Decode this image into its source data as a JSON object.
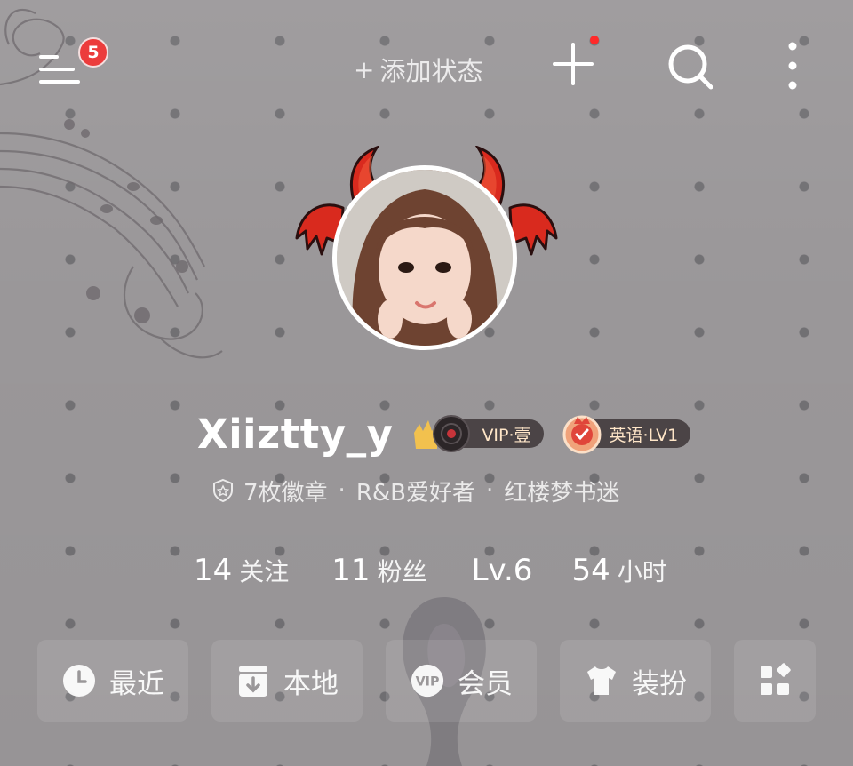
{
  "header": {
    "menu_badge": "5",
    "add_status_plus": "+",
    "add_status_label": "添加状态"
  },
  "profile": {
    "username": "Xiiztty_y",
    "vip_label": "VIP·壹",
    "level_badge_label": "英语·LV1",
    "badges_count": "7枚徽章",
    "separator": "·",
    "tag_1": "R&B爱好者",
    "tag_2": "红楼梦书迷"
  },
  "stats": {
    "following_num": "14",
    "following_label": "关注",
    "followers_num": "11",
    "followers_label": "粉丝",
    "level": "Lv.6",
    "hours_num": "54",
    "hours_label": "小时"
  },
  "quick_actions": {
    "recent": "最近",
    "local": "本地",
    "vip": "会员",
    "dress_up": "装扮"
  },
  "colors": {
    "background": "#9a9799",
    "badge_red": "#ec3c3c",
    "pill_dark": "#4b4446",
    "pill_text": "#ffe6c8"
  }
}
